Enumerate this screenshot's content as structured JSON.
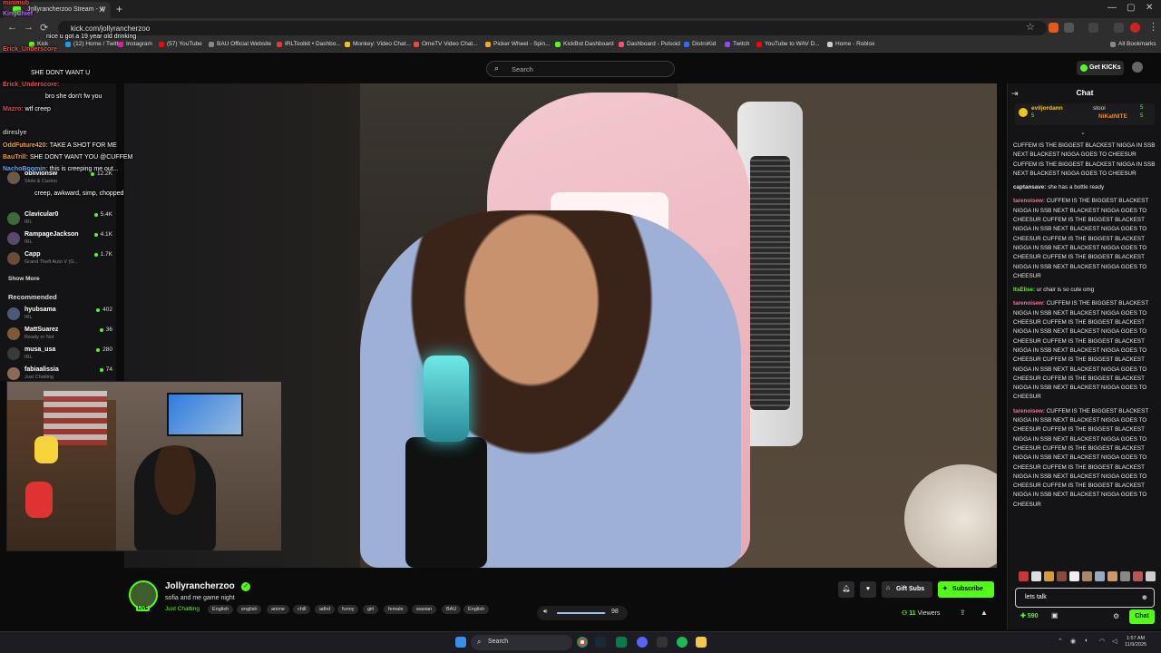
{
  "browser": {
    "tab_title": "Jollyrancherzoo Stream - W",
    "url": "kick.com/jollyrancherzoo",
    "bookmarks": [
      {
        "label": "Kick",
        "color": "#53fc18"
      },
      {
        "label": "(12) Home / Twitter",
        "color": "#1d9bf0"
      },
      {
        "label": "Instagram",
        "color": "#d6249f"
      },
      {
        "label": "(57) YouTube",
        "color": "#ff0000"
      },
      {
        "label": "BAU Official Website",
        "color": "#888888"
      },
      {
        "label": "IRLToolkit • Dashbo...",
        "color": "#e33b3b"
      },
      {
        "label": "Monkey: Video Chat...",
        "color": "#f0c419"
      },
      {
        "label": "OmeTV Video Chat...",
        "color": "#e94b3c"
      },
      {
        "label": "Picker Wheel - Spin...",
        "color": "#f5a623"
      },
      {
        "label": "KickBot Dashboard",
        "color": "#53fc18"
      },
      {
        "label": "Dashboard - Pulsoid",
        "color": "#ff4d6d"
      },
      {
        "label": "DistroKid",
        "color": "#2b6cff"
      },
      {
        "label": "Twitch",
        "color": "#9146ff"
      },
      {
        "label": "YouTube to WAV D...",
        "color": "#ff0000"
      },
      {
        "label": "Home - Roblox",
        "color": "#cccccc"
      }
    ],
    "all_bookmarks": "All Bookmarks"
  },
  "header": {
    "search_placeholder": "Search",
    "get_kicks": "Get KICKs"
  },
  "sidebar": {
    "following": [
      {
        "name": "oblivionsw",
        "category": "Slots & Casino",
        "viewers": "12.2K"
      },
      {
        "name": "Clavicular0",
        "category": "IRL",
        "viewers": "5.4K"
      },
      {
        "name": "RampageJackson",
        "category": "IRL",
        "viewers": "4.1K"
      },
      {
        "name": "Capp",
        "category": "Grand Theft Auto V (G...",
        "viewers": "1.7K"
      }
    ],
    "show_more": "Show More",
    "recommended_label": "Recommended",
    "recommended": [
      {
        "name": "hyubsama",
        "category": "IRL",
        "viewers": "402"
      },
      {
        "name": "MattSuarez",
        "category": "Ready or Not",
        "viewers": "36"
      },
      {
        "name": "musa_usa",
        "category": "IRL",
        "viewers": "280"
      },
      {
        "name": "fabiaalissia",
        "category": "Just Chatting",
        "viewers": "74"
      }
    ]
  },
  "overlay_chat": [
    {
      "user": "minimub",
      "text": "",
      "color": "#e05050"
    },
    {
      "user": "KingChief",
      "text": "",
      "color": "#c36cff"
    },
    {
      "user": "",
      "text": "nice u got a 19 year old drinking",
      "color": "#ffffff"
    },
    {
      "user": "Erick_Underscore",
      "text": "",
      "color": "#e05050"
    },
    {
      "user": "",
      "text": "SHE DONT WANT U",
      "color": "#ffffff"
    },
    {
      "user": "Erick_Underscore:",
      "text": "",
      "color": "#e05050"
    },
    {
      "user": "",
      "text": "bro she don't fw you",
      "color": "#ffffff"
    },
    {
      "user": "Mazro:",
      "text": "wtf creep",
      "color": "#e05050"
    },
    {
      "user": "direslye",
      "text": "",
      "color": "#bbbbbb"
    },
    {
      "user": "OddFuture420:",
      "text": "TAKE A SHOT FOR ME",
      "color": "#f0a020"
    },
    {
      "user": "BauTrill:",
      "text": "SHE DONT WANT YOU @CUFFEM",
      "color": "#f0a020"
    },
    {
      "user": "NachoBoomin:",
      "text": "this is creeping me out...",
      "color": "#5fa8ff"
    },
    {
      "user": "",
      "text": "creep, awkward, simp, chopped",
      "color": "#ffffff"
    }
  ],
  "stream": {
    "streamer": "Jollyrancherzoo",
    "title": "sofia and me game night",
    "category": "Just Chatting",
    "tags": [
      "English",
      "english",
      "anime",
      "chill",
      "adhd",
      "funny",
      "girl",
      "female",
      "wasian",
      "BAU",
      "English"
    ],
    "gift_subs": "Gift Subs",
    "subscribe": "Subscribe",
    "viewers": "11",
    "viewers_label": "Viewers",
    "live_badge": "LIVE",
    "volume": "98",
    "volume_level": 0.98
  },
  "chat": {
    "title": "Chat",
    "pinned": [
      {
        "user": "eviljordann",
        "count": "5"
      },
      {
        "user": "stooi",
        "count": "5"
      },
      {
        "user": "NiKatNITE",
        "count": "5"
      }
    ],
    "messages": [
      {
        "user": "",
        "text": "CUFFEM IS THE BIGGEST BLACKEST NIGGA IN SSB NEXT BLACKEST NIGGA GOES TO CHEESUR CUFFEM IS THE BIGGEST BLACKEST NIGGA IN SSB NEXT BLACKEST NIGGA GOES TO CHEESUR",
        "color": "#ffffff"
      },
      {
        "user": "captansave:",
        "text": "she has a bottle ready",
        "color": "#e0e0e0"
      },
      {
        "user": "tarenoisew:",
        "text": "CUFFEM IS THE BIGGEST BLACKEST NIGGA IN SSB NEXT BLACKEST NIGGA GOES TO CHEESUR CUFFEM IS THE BIGGEST BLACKEST NIGGA IN SSB NEXT BLACKEST NIGGA GOES TO CHEESUR CUFFEM IS THE BIGGEST BLACKEST NIGGA IN SSB NEXT BLACKEST NIGGA GOES TO CHEESUR CUFFEM IS THE BIGGEST BLACKEST NIGGA IN SSB NEXT BLACKEST NIGGA GOES TO CHEESUR",
        "color": "#ff6b8a"
      },
      {
        "user": "ItsElise:",
        "text": "ur chair is so cute omg",
        "color": "#53fc18"
      },
      {
        "user": "tarenoisew:",
        "text": "CUFFEM IS THE BIGGEST BLACKEST NIGGA IN SSB NEXT BLACKEST NIGGA GOES TO CHEESUR CUFFEM IS THE BIGGEST BLACKEST NIGGA IN SSB NEXT BLACKEST NIGGA GOES TO CHEESUR CUFFEM IS THE BIGGEST BLACKEST NIGGA IN SSB NEXT BLACKEST NIGGA GOES TO CHEESUR CUFFEM IS THE BIGGEST BLACKEST NIGGA IN SSB NEXT BLACKEST NIGGA GOES TO CHEESUR CUFFEM IS THE BIGGEST BLACKEST NIGGA IN SSB NEXT BLACKEST NIGGA GOES TO CHEESUR",
        "color": "#ff6b8a"
      },
      {
        "user": "tarenoisew:",
        "text": "CUFFEM IS THE BIGGEST BLACKEST NIGGA IN SSB NEXT BLACKEST NIGGA GOES TO CHEESUR CUFFEM IS THE BIGGEST BLACKEST NIGGA IN SSB NEXT BLACKEST NIGGA GOES TO CHEESUR CUFFEM IS THE BIGGEST BLACKEST NIGGA IN SSB NEXT BLACKEST NIGGA GOES TO CHEESUR CUFFEM IS THE BIGGEST BLACKEST NIGGA IN SSB NEXT BLACKEST NIGGA GOES TO CHEESUR CUFFEM IS THE BIGGEST BLACKEST NIGGA IN SSB NEXT BLACKEST NIGGA GOES TO CHEESUR",
        "color": "#ff6b8a"
      }
    ],
    "input_value": "lets talk",
    "points": "590",
    "send_label": "Chat"
  },
  "taskbar": {
    "search_placeholder": "Search",
    "time": "1:57 AM",
    "date": "11/9/2025"
  },
  "colors": {
    "accent": "#53fc18",
    "background": "#0b0b0c",
    "panel": "#141416"
  }
}
